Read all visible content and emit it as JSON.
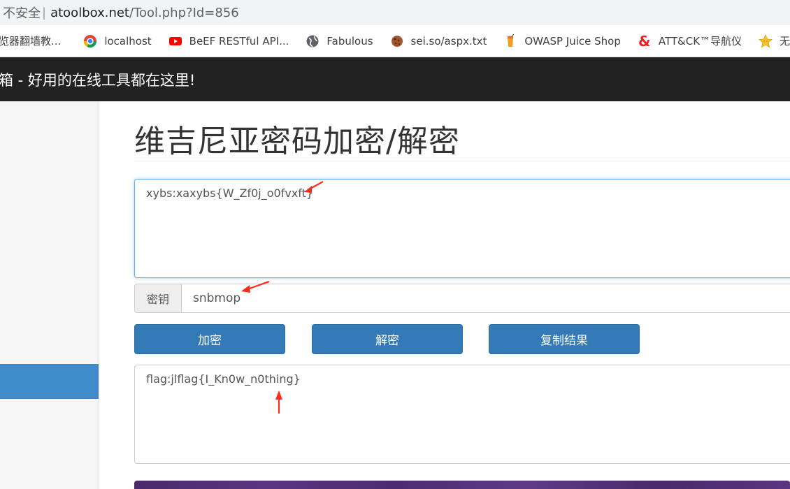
{
  "browser": {
    "insecure_label": "不安全",
    "separator": "|",
    "url_domain": "atoolbox.net",
    "url_path": "/Tool.php?Id=856"
  },
  "bookmarks": [
    {
      "label": "览器翻墙教...",
      "icon": "page-icon"
    },
    {
      "label": "localhost",
      "icon": "chrome-icon"
    },
    {
      "label": "BeEF RESTful API...",
      "icon": "youtube-icon"
    },
    {
      "label": "Fabulous",
      "icon": "globe-icon"
    },
    {
      "label": "sei.so/aspx.txt",
      "icon": "cookie-icon"
    },
    {
      "label": "OWASP Juice Shop",
      "icon": "juice-icon"
    },
    {
      "label": "ATT&CK™导航仪",
      "icon": "ampersand-icon"
    },
    {
      "label": "无法加载",
      "icon": "star-icon"
    }
  ],
  "site_header": {
    "title": "箱 - 好用的在线工具都在这里!"
  },
  "main": {
    "page_title": "维吉尼亚密码加密/解密",
    "input_text": "xybs:xaxybs{W_Zf0j_o0fvxft}",
    "key_label": "密钥",
    "key_value": "snbmop",
    "buttons": {
      "encrypt": "加密",
      "decrypt": "解密",
      "copy": "复制结果"
    },
    "output_text": "flag:jlflag{I_Kn0w_n0thing}"
  },
  "colors": {
    "header_bg": "#222222",
    "button_bg": "#337ab7",
    "sidebar_active": "#428bca",
    "annotation_arrow": "#ff2a1a"
  }
}
